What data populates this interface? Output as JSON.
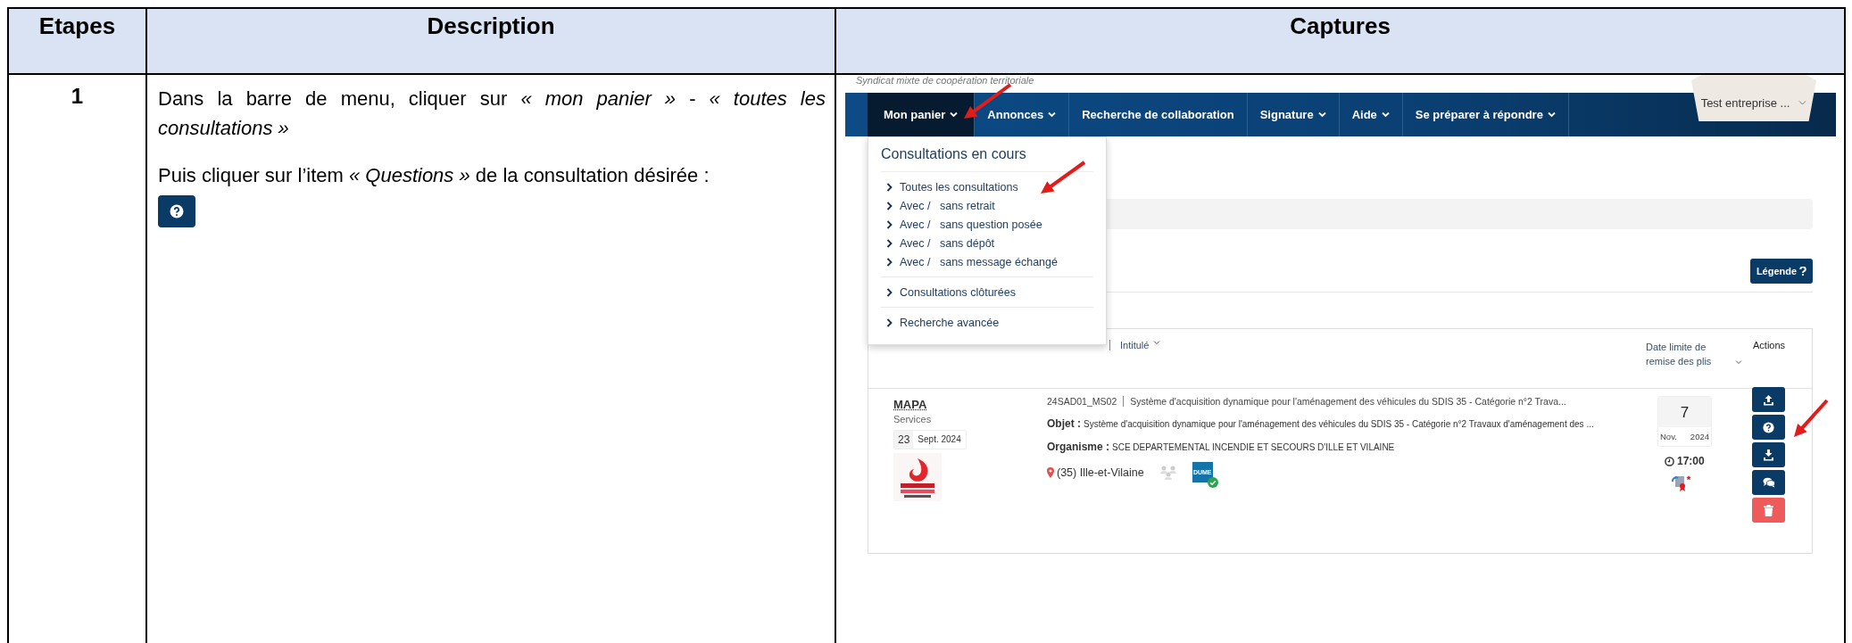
{
  "columns": [
    "Etapes",
    "Description",
    "Captures"
  ],
  "steps": [
    {
      "number": "1",
      "paragraphs": [
        "Dans la barre de menu, cliquer sur *« mon panier »* - *« toutes les consultations »*",
        "Puis cliquer sur l’item *« Questions »* de la consultation désirée :"
      ],
      "capture": {
        "org_caption": "Syndicat mixte de coopération territoriale",
        "nav": [
          {
            "label": "Mon panier",
            "dropdown": true,
            "selected": true
          },
          {
            "label": "Annonces",
            "dropdown": true,
            "selected": false
          },
          {
            "label": "Recherche de collaboration",
            "dropdown": false,
            "selected": false
          },
          {
            "label": "Signature",
            "dropdown": true,
            "selected": false
          },
          {
            "label": "Aide",
            "dropdown": true,
            "selected": false
          },
          {
            "label": "Se préparer à répondre",
            "dropdown": true,
            "selected": false
          }
        ],
        "account": "Test entreprise ...",
        "menu": {
          "heading": "Consultations en cours",
          "groups": [
            [
              "Toutes les consultations",
              "Avec /   sans retrait",
              "Avec /   sans question posée",
              "Avec /   sans dépôt",
              "Avec /   sans message échangé"
            ],
            [
              "Consultations clôturées"
            ],
            [
              "Recherche avancée"
            ]
          ]
        },
        "legend_button": "Légende",
        "table": {
          "columns": [
            "Intitulé",
            "Date limite de remise des plis",
            "Actions"
          ],
          "row": {
            "procedure": "MAPA",
            "category": "Services",
            "pub_day": "23",
            "pub_month": "Sept. 2024",
            "reference": "24SAD01_MS02",
            "title": "Système d'acquisition dynamique pour l'aménagement des véhicules du SDIS 35 - Catégorie n°2 Trava...",
            "object_label": "Objet :",
            "object": "Système d'acquisition dynamique pour l'aménagement des véhicules du SDIS 35 - Catégorie n°2 Travaux d'aménagement des ...",
            "org_label": "Organisme :",
            "organisation": "SCE DEPARTEMENTAL INCENDIE ET SECOURS D'ILLE ET VILAINE",
            "location": "(35) Ille-et-Vilaine",
            "dume": "DUME",
            "deadline_day": "7",
            "deadline_month": "Nov.",
            "deadline_year": "2024",
            "deadline_time": "17:00",
            "actions": [
              {
                "kind": "upload"
              },
              {
                "kind": "question"
              },
              {
                "kind": "download"
              },
              {
                "kind": "chat"
              },
              {
                "kind": "delete"
              }
            ]
          }
        }
      }
    }
  ]
}
